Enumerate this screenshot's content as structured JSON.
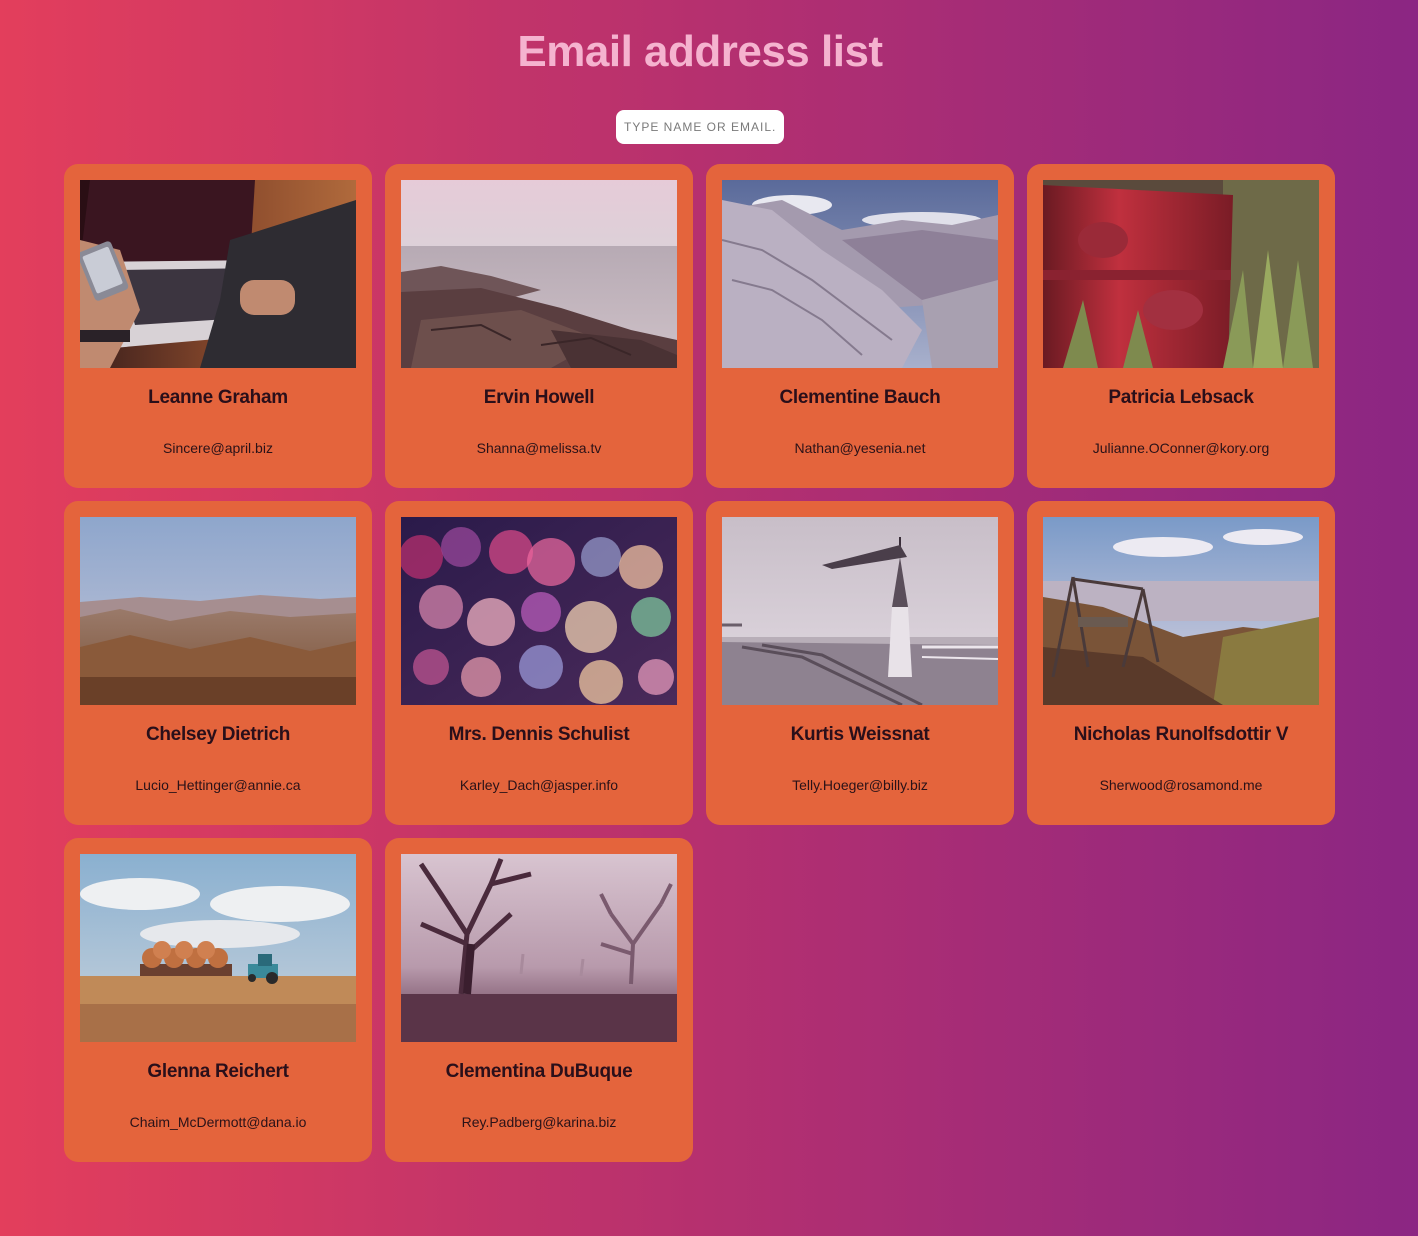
{
  "page": {
    "title": "Email address list",
    "background_gradient": [
      "#e33e5c",
      "#b5306f",
      "#8b2683"
    ],
    "card_color": "#e4643c"
  },
  "search": {
    "placeholder": "TYPE NAME OR EMAIL..",
    "value": ""
  },
  "cards": [
    {
      "name": "Leanne Graham",
      "email": "Sincere@april.biz",
      "photo": "laptop-phone-photo"
    },
    {
      "name": "Ervin Howell",
      "email": "Shanna@melissa.tv",
      "photo": "rocky-coast-photo"
    },
    {
      "name": "Clementine Bauch",
      "email": "Nathan@yesenia.net",
      "photo": "snowy-mountains-photo"
    },
    {
      "name": "Patricia Lebsack",
      "email": "Julianne.OConner@kory.org",
      "photo": "rusty-barrel-photo"
    },
    {
      "name": "Chelsey Dietrich",
      "email": "Lucio_Hettinger@annie.ca",
      "photo": "rolling-hills-photo"
    },
    {
      "name": "Mrs. Dennis Schulist",
      "email": "Karley_Dach@jasper.info",
      "photo": "bokeh-lights-photo"
    },
    {
      "name": "Kurtis Weissnat",
      "email": "Telly.Hoeger@billy.biz",
      "photo": "pier-windvane-photo"
    },
    {
      "name": "Nicholas Runolfsdottir V",
      "email": "Sherwood@rosamond.me",
      "photo": "lakeside-swing-photo"
    },
    {
      "name": "Glenna Reichert",
      "email": "Chaim_McDermott@dana.io",
      "photo": "hay-tractor-photo"
    },
    {
      "name": "Clementina DuBuque",
      "email": "Rey.Padberg@karina.biz",
      "photo": "foggy-trees-photo"
    }
  ]
}
